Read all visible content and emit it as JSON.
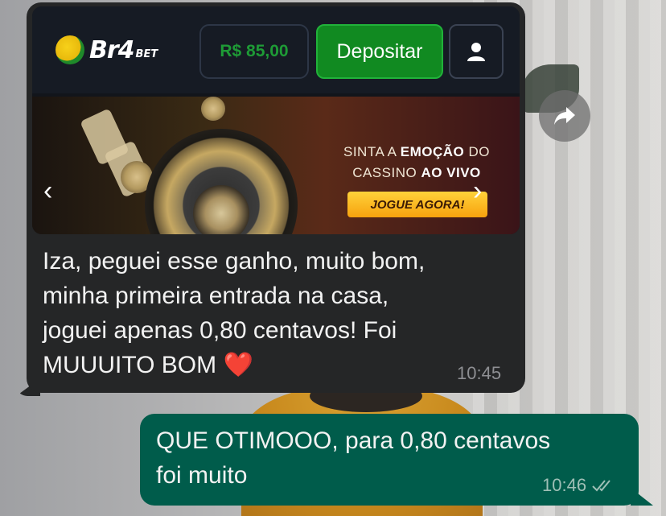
{
  "incoming": {
    "site": {
      "logo_text": "Br4",
      "logo_suffix": "BET",
      "balance": "R$ 85,00",
      "deposit_label": "Depositar"
    },
    "banner": {
      "line1_prefix": "SINTA A ",
      "line1_bold": "EMOÇÃO",
      "line1_suffix": " DO",
      "line2_prefix": "CASSINO ",
      "line2_bold": "AO VIVO",
      "cta": "JOGUE AGORA!"
    },
    "text_line1": "Iza, peguei esse ganho, muito bom,",
    "text_line2": "minha primeira entrada na casa,",
    "text_line3": "joguei apenas 0,80 centavos! Foi",
    "text_line4": "MUUUITO BOM",
    "emoji": "❤️",
    "time": "10:45"
  },
  "outgoing": {
    "text_line1": "QUE OTIMOOO, para 0,80 centavos",
    "text_line2": "foi muito",
    "time": "10:46"
  },
  "colors": {
    "incoming_bubble": "#252627",
    "outgoing_bubble": "#005c4b",
    "deposit_green": "#118a21",
    "balance_green": "#1e9b36"
  },
  "icons": [
    "user-icon",
    "chevron-left-icon",
    "chevron-right-icon",
    "forward-icon",
    "double-check-icon"
  ]
}
